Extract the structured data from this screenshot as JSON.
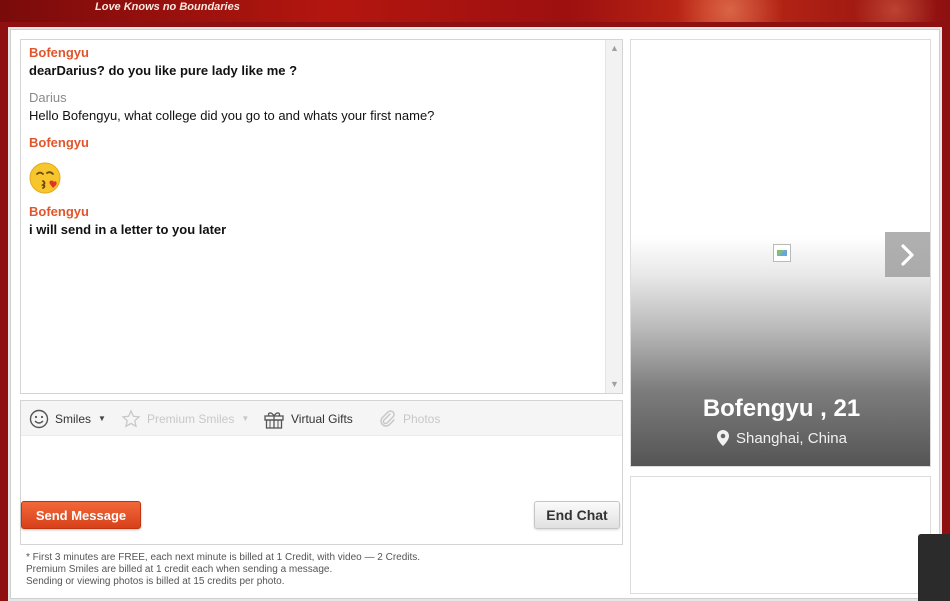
{
  "banner": {
    "tagline": "Love Knows no Boundaries"
  },
  "chat": {
    "messages": [
      {
        "sender": "Bofengyu",
        "text": "dearDarius? do you like pure lady like me ?",
        "is_self": false
      },
      {
        "sender": "Darius",
        "text": "Hello Bofengyu, what college did you go to and whats your first name?",
        "is_self": true
      },
      {
        "sender": "Bofengyu",
        "emoji": "kiss-face",
        "is_self": false
      },
      {
        "sender": "Bofengyu",
        "text": "i will send in a letter to you later",
        "is_self": false
      }
    ]
  },
  "toolbar": {
    "smiles": "Smiles",
    "premium_smiles": "Premium Smiles",
    "virtual_gifts": "Virtual Gifts",
    "photos": "Photos"
  },
  "buttons": {
    "send": "Send Message",
    "end_chat": "End Chat"
  },
  "notes": [
    "* First 3 minutes are FREE, each next minute is billed at 1 Credit, with video — 2 Credits.",
    "Premium Smiles are billed at 1 credit each when sending a message.",
    "Sending or viewing photos is billed at 15 credits per photo."
  ],
  "profile": {
    "name_age": "Bofengyu , 21",
    "location": "Shanghai, China"
  },
  "colors": {
    "accent": "#e0552b",
    "send_button": "#e8532a",
    "banner": "#9d1010"
  },
  "icons": {
    "smiles": "smiley-face-icon",
    "premium_smiles": "star-icon",
    "virtual_gifts": "gift-icon",
    "photos": "paperclip-icon",
    "next": "chevron-right-icon",
    "location": "map-pin-icon"
  }
}
